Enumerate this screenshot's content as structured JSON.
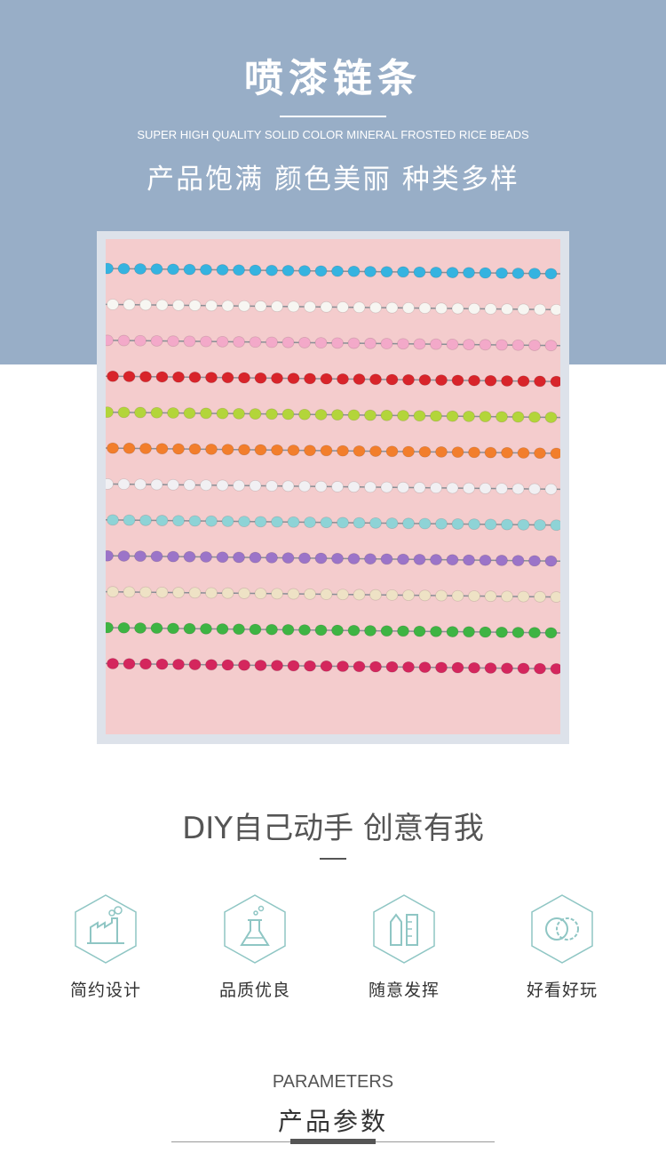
{
  "header": {
    "title": "喷漆链条",
    "subtitle_en": "SUPER HIGH QUALITY SOLID COLOR MINERAL FROSTED RICE BEADS",
    "subtitle_zh": "产品饱满 颜色美丽 种类多样"
  },
  "photo": {
    "background": "#f4cccd",
    "chain_colors": [
      "#35b3e0",
      "#f7f6f2",
      "#f3a9c9",
      "#d8242a",
      "#b3d53a",
      "#f27e2c",
      "#f1f0f3",
      "#8ed3d6",
      "#9b74c8",
      "#eee2c5",
      "#3eb443",
      "#d4265d"
    ]
  },
  "diy": {
    "title": "DIY自己动手 创意有我"
  },
  "features": [
    {
      "icon": "factory-icon",
      "label": "简约设计"
    },
    {
      "icon": "flask-icon",
      "label": "品质优良"
    },
    {
      "icon": "ruler-icon",
      "label": "随意发挥"
    },
    {
      "icon": "rings-icon",
      "label": "好看好玩"
    }
  ],
  "parameters": {
    "title_en": "PARAMETERS",
    "title_zh": "产品参数"
  },
  "colors": {
    "band": "#98aec7",
    "icon_accent": "#8fc6c4"
  }
}
